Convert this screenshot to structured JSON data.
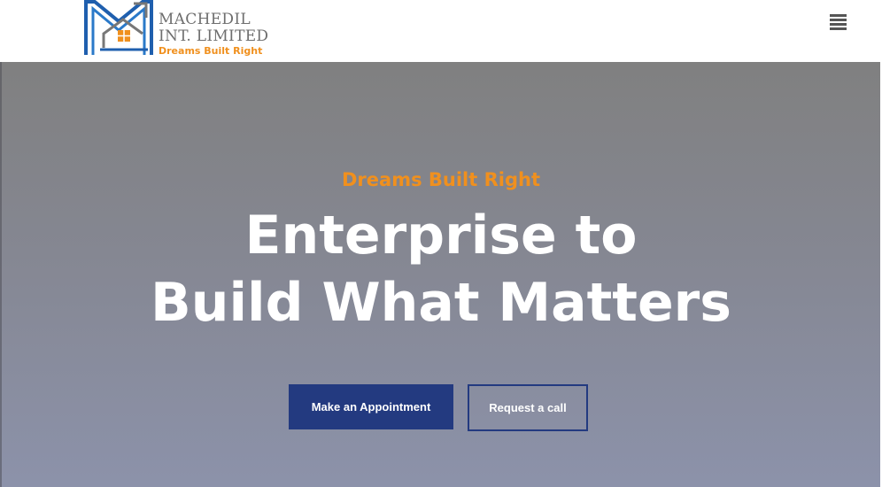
{
  "header": {
    "logo": {
      "line1": "MACHEDIL",
      "line2": "INT. LIMITED",
      "tagline": "Dreams Built Right",
      "colors": {
        "blue": "#1f5fae",
        "orange": "#f0901e",
        "gray": "#6e6e6e"
      }
    },
    "menu_icon": "hamburger-menu-icon"
  },
  "hero": {
    "tagline": "Dreams Built Right",
    "title_line1": "Enterprise to",
    "title_line2": "Build What Matters",
    "primary_button": "Make an Appointment",
    "secondary_button": "Request a call",
    "colors": {
      "accent": "#f0901e",
      "button": "#233a80",
      "text": "#ffffff"
    }
  }
}
